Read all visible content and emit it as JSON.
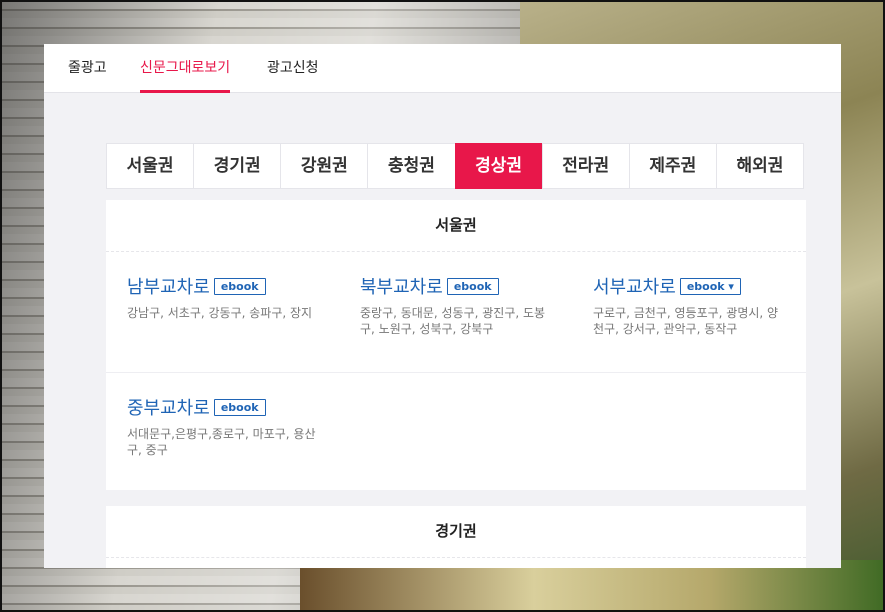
{
  "top_tabs": [
    {
      "label": "줄광고"
    },
    {
      "label": "신문그대로보기"
    },
    {
      "label": "광고신청"
    }
  ],
  "region_tabs": [
    "서울권",
    "경기권",
    "강원권",
    "충청권",
    "경상권",
    "전라권",
    "제주권",
    "해외권"
  ],
  "active_region_index": 4,
  "sections": [
    {
      "title": "서울권",
      "items": [
        {
          "name": "남부교차로",
          "badge": "ebook",
          "areas": "강남구, 서초구, 강동구, 송파구, 장지"
        },
        {
          "name": "북부교차로",
          "badge": "ebook",
          "areas": "중랑구, 동대문, 성동구, 광진구, 도봉구, 노원구, 성북구, 강북구"
        },
        {
          "name": "서부교차로",
          "badge": "ebook ▾",
          "areas": "구로구, 금천구, 영등포구, 광명시, 양천구, 강서구, 관악구, 동작구"
        },
        {
          "name": "중부교차로",
          "badge": "ebook",
          "areas": "서대문구,은평구,종로구, 마포구, 용산구, 중구"
        }
      ]
    },
    {
      "title": "경기권"
    }
  ],
  "colors": {
    "accent": "#e8174a",
    "link": "#1f64b5"
  }
}
